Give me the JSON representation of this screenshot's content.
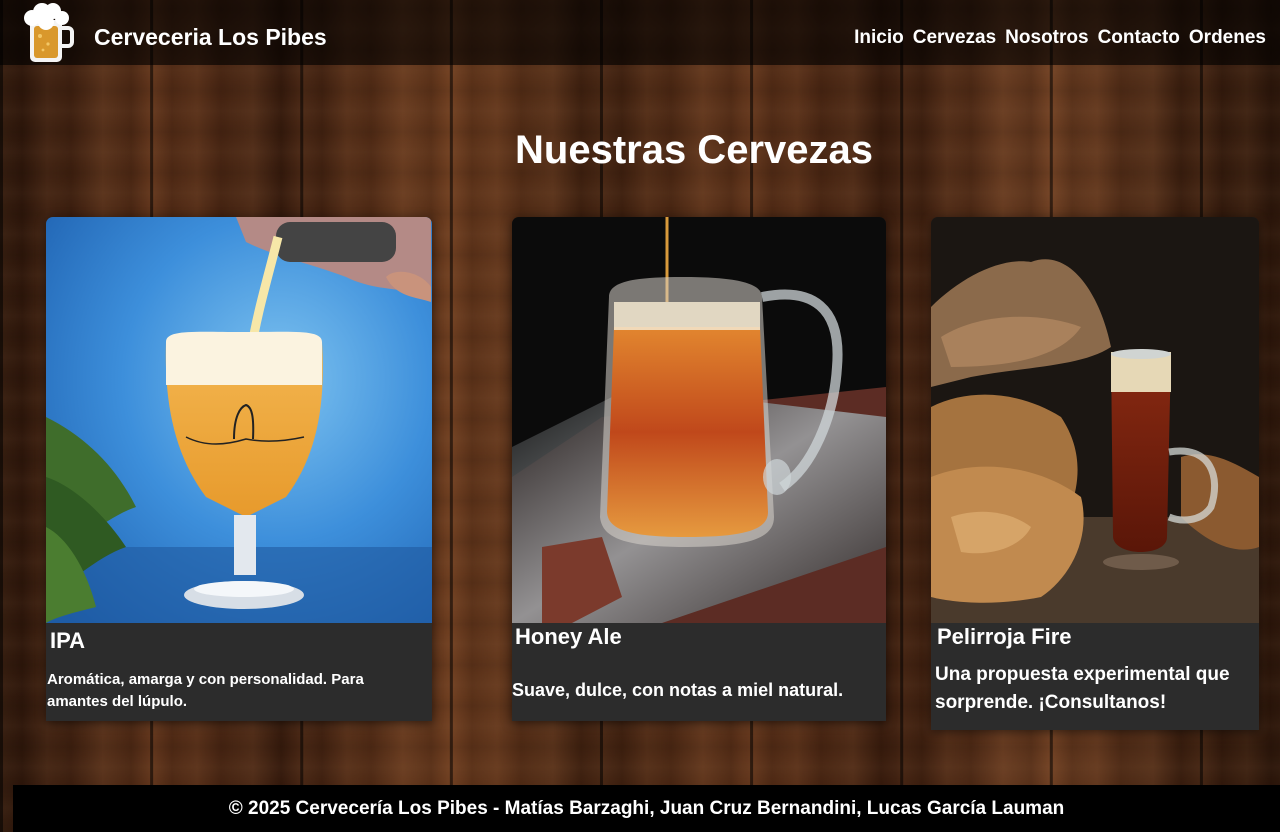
{
  "header": {
    "logo_icon": "beer-mug-icon",
    "brand": "Cerveceria Los Pibes",
    "nav": [
      {
        "label": "Inicio"
      },
      {
        "label": "Cervezas"
      },
      {
        "label": "Nosotros"
      },
      {
        "label": "Contacto"
      },
      {
        "label": "Ordenes"
      }
    ]
  },
  "main": {
    "title": "Nuestras Cervezas",
    "cards": [
      {
        "name": "IPA",
        "description": "Aromática, amarga y con personalidad. Para amantes del lúpulo.",
        "image": "ipa-beer-being-poured-into-tulip-glass"
      },
      {
        "name": "Honey Ale",
        "description": "Suave, dulce, con notas a miel natural.",
        "image": "honey-ale-in-glass-mug-on-tray"
      },
      {
        "name": "Pelirroja Fire",
        "description": "Una propuesta experimental que sorprende. ¡Consultanos!",
        "image": "red-beer-glass-with-bread"
      }
    ]
  },
  "footer": {
    "text": "© 2025 Cervecería Los Pibes - Matías Barzaghi, Juan Cruz Bernandini, Lucas García Lauman"
  },
  "colors": {
    "header_bg": "#000000",
    "card_bg": "#2c2c2c",
    "text": "#ffffff",
    "wood": "#4a2614"
  }
}
